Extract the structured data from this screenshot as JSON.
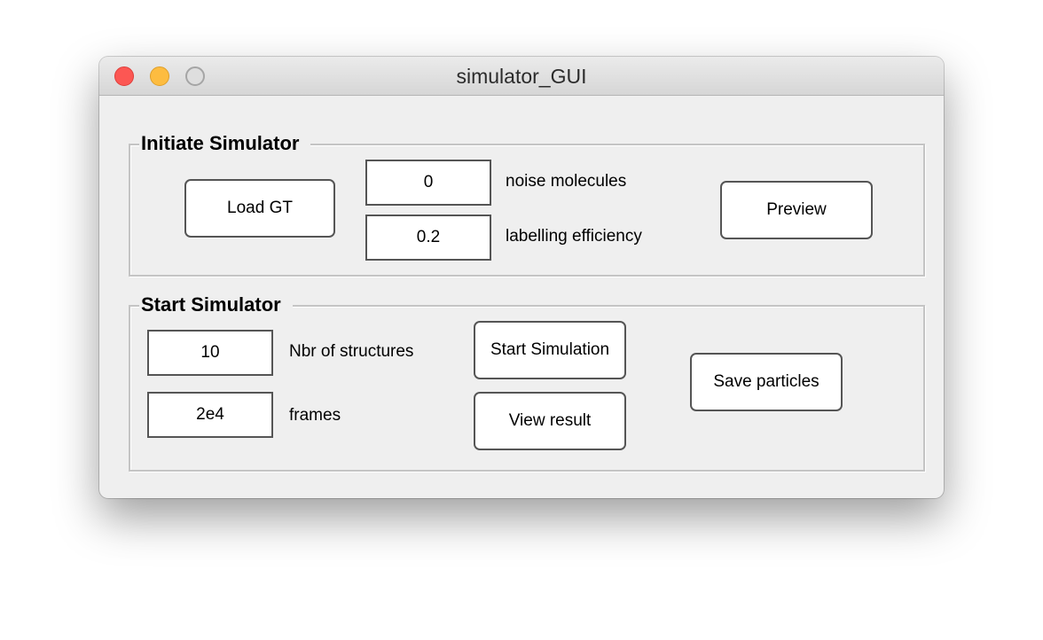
{
  "window": {
    "title": "simulator_GUI"
  },
  "initiate_panel": {
    "title": "Initiate Simulator",
    "load_gt_label": "Load GT",
    "noise_molecules_value": "0",
    "noise_molecules_label": "noise molecules",
    "labelling_efficiency_value": "0.2",
    "labelling_efficiency_label": "labelling efficiency",
    "preview_label": "Preview"
  },
  "start_panel": {
    "title": "Start Simulator",
    "nbr_structures_value": "10",
    "nbr_structures_label": "Nbr of structures",
    "frames_value": "2e4",
    "frames_label": "frames",
    "start_simulation_label": "Start Simulation",
    "view_result_label": "View result",
    "save_particles_label": "Save particles"
  },
  "colors": {
    "close": "#fc5753",
    "minimize": "#fdbc40",
    "zoom": "#dedede",
    "window_bg": "#efefef"
  }
}
